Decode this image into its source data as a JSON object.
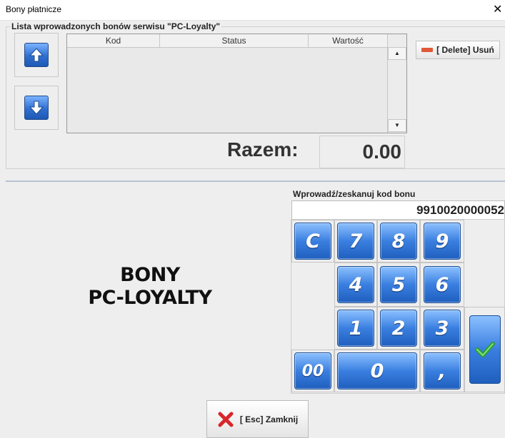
{
  "window": {
    "title": "Bony płatnicze",
    "close_glyph": "✕"
  },
  "list": {
    "legend": "Lista wprowadzonych bonów serwisu \"PC-Loyalty\"",
    "columns": [
      "Kod",
      "Status",
      "Wartość"
    ],
    "rows": [],
    "scroll_up_glyph": "▲",
    "scroll_down_glyph": "▼"
  },
  "nav": {
    "up_icon": "arrow-up-icon",
    "down_icon": "arrow-down-icon"
  },
  "delete_button": {
    "label": "[ Delete] Usuń",
    "icon": "minus-icon"
  },
  "total": {
    "label": "Razem:",
    "value": "0.00"
  },
  "brand": {
    "line1": "BONY",
    "line2": "PC-LOYALTY"
  },
  "code_input": {
    "legend": "Wprowadź/zeskanuj kod bonu",
    "value": "9910020000052"
  },
  "keypad": {
    "clear": "C",
    "k7": "7",
    "k8": "8",
    "k9": "9",
    "k4": "4",
    "k5": "5",
    "k6": "6",
    "k1": "1",
    "k2": "2",
    "k3": "3",
    "k00": "00",
    "k0": "0",
    "comma": ",",
    "ok_icon": "checkmark-icon"
  },
  "close_button": {
    "label": "[ Esc] Zamknij",
    "icon": "red-x-icon"
  },
  "colors": {
    "key_blue": "#3a7fe0",
    "ok_green": "#2e9e3a",
    "close_red": "#d8262b",
    "delete_red": "#e05a3a"
  }
}
